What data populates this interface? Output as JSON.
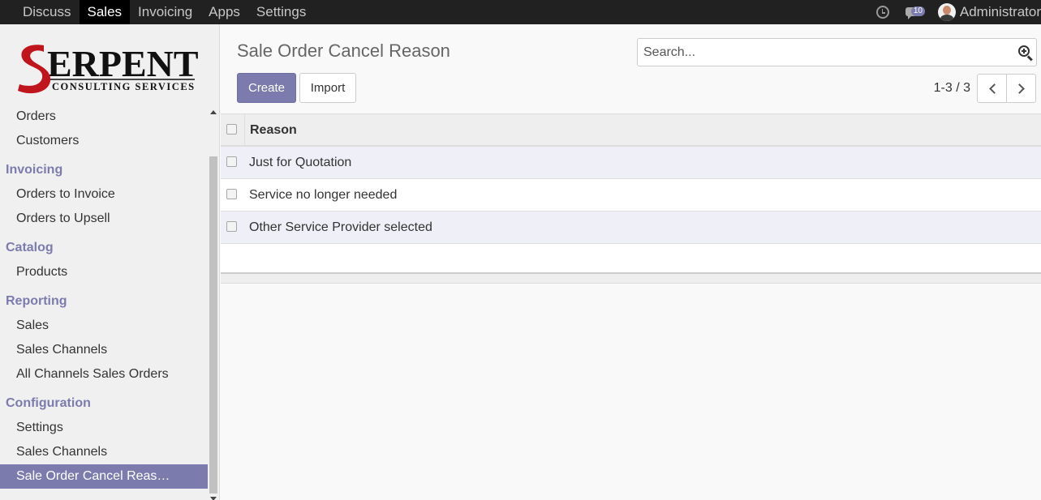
{
  "topbar": {
    "nav": [
      "Discuss",
      "Sales",
      "Invoicing",
      "Apps",
      "Settings"
    ],
    "active": "Sales",
    "messages_count": "10",
    "user_name": "Administrator",
    "icons": [
      "clock-icon",
      "chat-icon",
      "avatar"
    ]
  },
  "logo": {
    "brand": "SERPENT",
    "tagline": "CONSULTING SERVICES"
  },
  "sidebar": {
    "sections": [
      {
        "title": "",
        "items": [
          "Orders",
          "Customers"
        ]
      },
      {
        "title": "Invoicing",
        "items": [
          "Orders to Invoice",
          "Orders to Upsell"
        ]
      },
      {
        "title": "Catalog",
        "items": [
          "Products"
        ]
      },
      {
        "title": "Reporting",
        "items": [
          "Sales",
          "Sales Channels",
          "All Channels Sales Orders"
        ]
      },
      {
        "title": "Configuration",
        "items": [
          "Settings",
          "Sales Channels",
          "Sale Order Cancel Reas…"
        ]
      }
    ],
    "active_item": "Sale Order Cancel Reas…"
  },
  "page": {
    "title": "Sale Order Cancel Reason",
    "create_label": "Create",
    "import_label": "Import",
    "search_placeholder": "Search...",
    "pager": "1-3 / 3"
  },
  "list": {
    "column": "Reason",
    "rows": [
      "Just for Quotation",
      "Service no longer needed",
      "Other Service Provider selected"
    ]
  },
  "colors": {
    "accent": "#7c7bad",
    "topbar": "#212121",
    "row_alt": "#efeff7"
  }
}
